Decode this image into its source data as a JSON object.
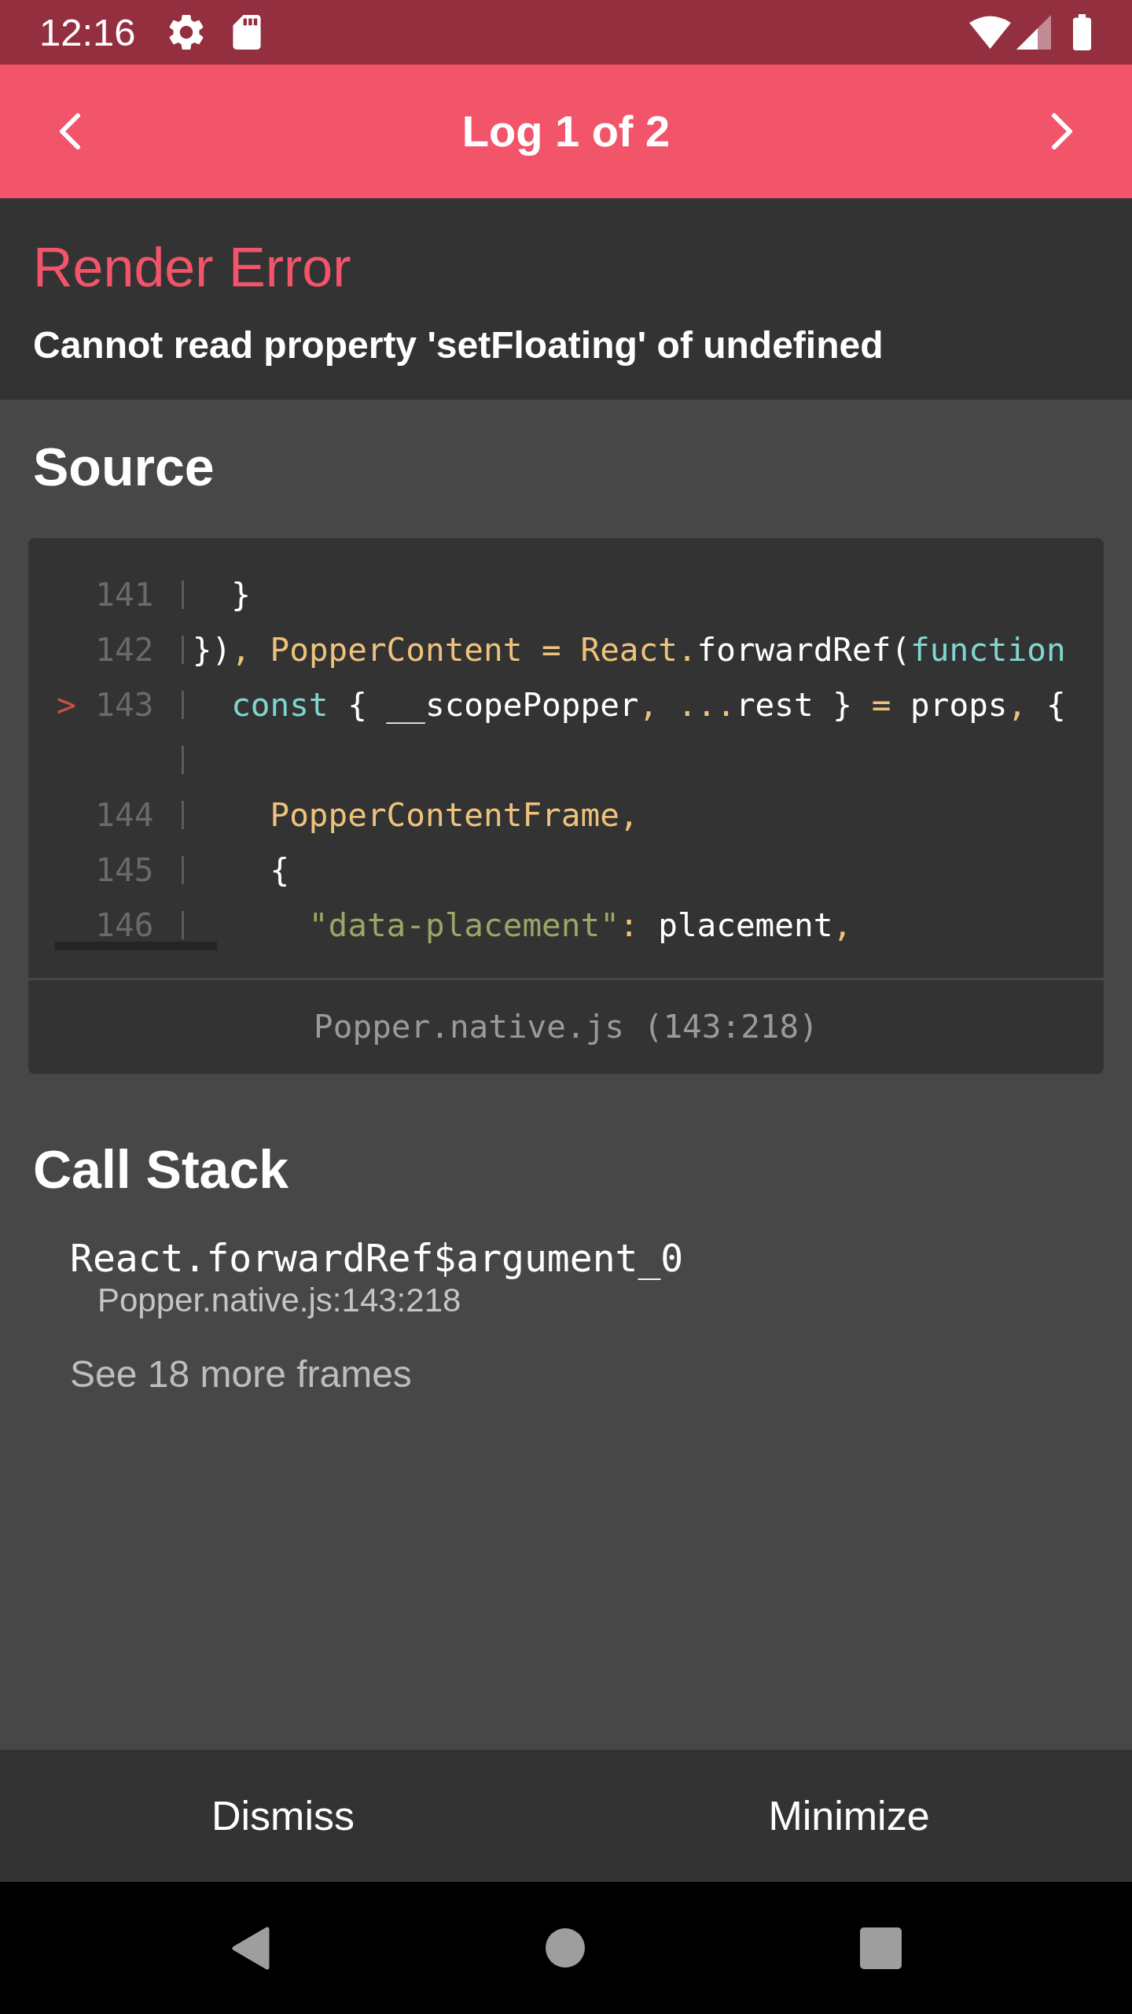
{
  "status_bar": {
    "time": "12:16"
  },
  "header": {
    "title": "Log 1 of 2"
  },
  "error": {
    "title": "Render Error",
    "message": "Cannot read property 'setFloating' of undefined"
  },
  "source": {
    "heading": "Source",
    "lines": [
      {
        "kind": "code",
        "number": "141",
        "tokens": [
          {
            "text": "  }",
            "kind": "plain"
          }
        ]
      },
      {
        "kind": "code",
        "number": "142",
        "tokens": [
          {
            "text": "})",
            "kind": "plain"
          },
          {
            "text": ", PopperContent = React.",
            "kind": "accent"
          },
          {
            "text": "forwardRef(",
            "kind": "plain"
          },
          {
            "text": "function",
            "kind": "keyword"
          }
        ]
      },
      {
        "kind": "code",
        "marker": ">",
        "number": "143",
        "tokens": [
          {
            "text": "  const",
            "kind": "keyword"
          },
          {
            "text": " { __scopePopper",
            "kind": "plain"
          },
          {
            "text": ", ...",
            "kind": "accent"
          },
          {
            "text": "rest } ",
            "kind": "plain"
          },
          {
            "text": "=",
            "kind": "accent"
          },
          {
            "text": " props",
            "kind": "plain"
          },
          {
            "text": ",",
            "kind": "accent"
          },
          {
            "text": " {",
            "kind": "plain"
          }
        ]
      },
      {
        "kind": "wrap"
      },
      {
        "kind": "code",
        "number": "144",
        "tokens": [
          {
            "text": "    PopperContentFrame,",
            "kind": "accent"
          }
        ]
      },
      {
        "kind": "code",
        "number": "145",
        "tokens": [
          {
            "text": "    {",
            "kind": "plain"
          }
        ]
      },
      {
        "kind": "code",
        "number": "146",
        "tokens": [
          {
            "text": "      \"data-placement\"",
            "kind": "string"
          },
          {
            "text": ":",
            "kind": "accent"
          },
          {
            "text": " placement",
            "kind": "plain"
          },
          {
            "text": ",",
            "kind": "accent"
          }
        ]
      }
    ],
    "file": "Popper.native.js (143:218)"
  },
  "call_stack": {
    "heading": "Call Stack",
    "frames": [
      {
        "function": "React.forwardRef$argument_0",
        "location": "Popper.native.js:143:218"
      }
    ],
    "more_frames": "See 18 more frames"
  },
  "actions": [
    "Dismiss",
    "Minimize"
  ]
}
